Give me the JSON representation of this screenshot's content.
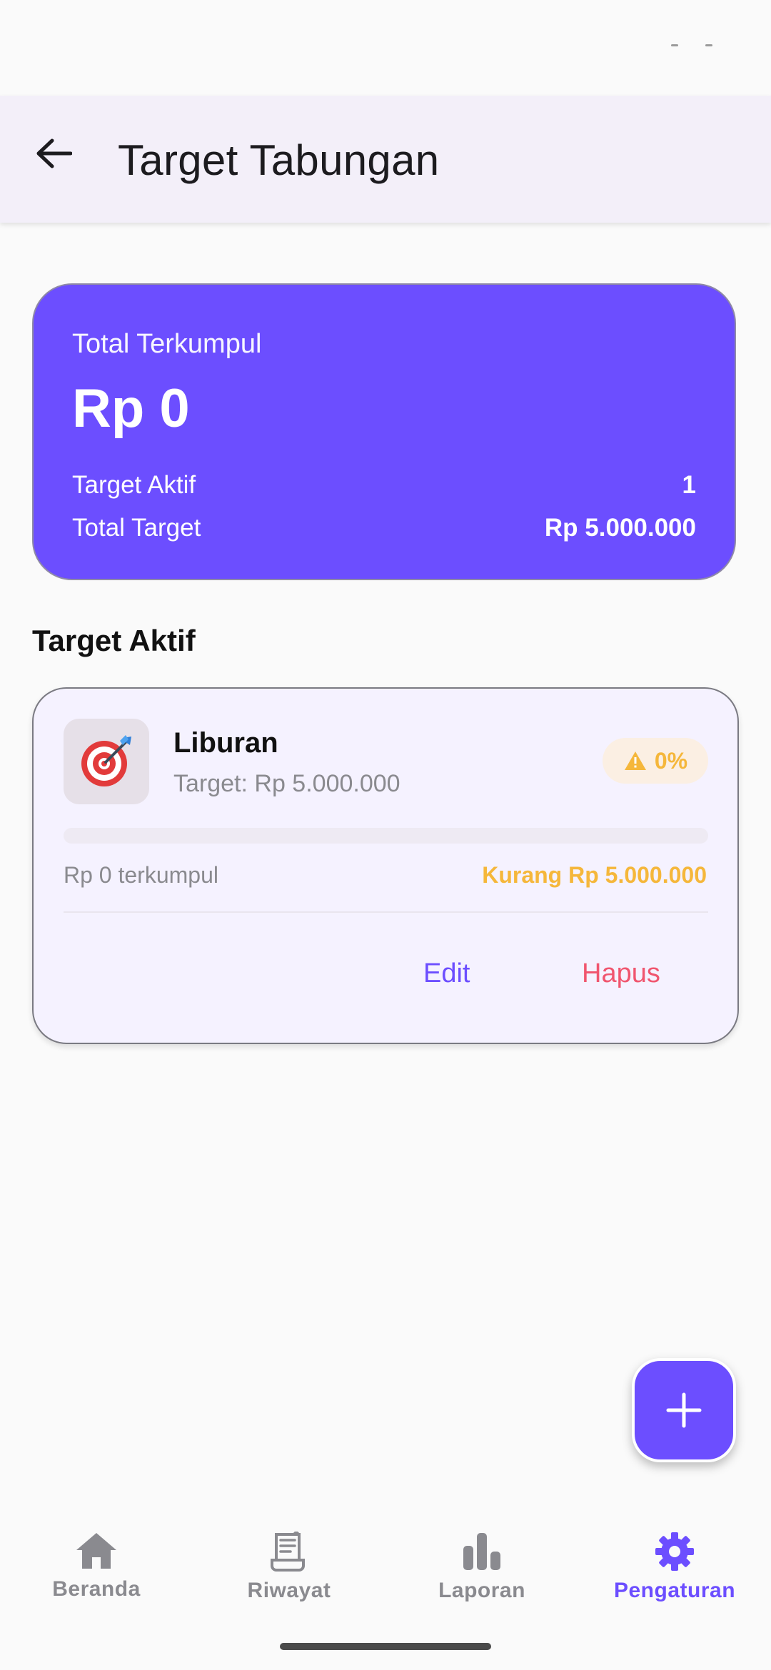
{
  "app_bar": {
    "title": "Target Tabungan"
  },
  "summary": {
    "label": "Total Terkumpul",
    "amount": "Rp 0",
    "active_targets_label": "Target Aktif",
    "active_targets_value": "1",
    "total_target_label": "Total Target",
    "total_target_value": "Rp 5.000.000"
  },
  "section_title": "Target Aktif",
  "goal": {
    "icon": "target-emoji-icon",
    "name": "Liburan",
    "target_text": "Target: Rp 5.000.000",
    "percent": "0%",
    "progress_fraction": 0,
    "collected_text": "Rp 0 terkumpul",
    "shortfall_text": "Kurang Rp 5.000.000",
    "edit_label": "Edit",
    "delete_label": "Hapus"
  },
  "bottom_nav": {
    "items": [
      {
        "label": "Beranda",
        "icon": "home-icon"
      },
      {
        "label": "Riwayat",
        "icon": "receipt-icon"
      },
      {
        "label": "Laporan",
        "icon": "bar-chart-icon"
      },
      {
        "label": "Pengaturan",
        "icon": "gear-icon"
      }
    ],
    "active": "Pengaturan"
  },
  "colors": {
    "primary": "#6C4EFF",
    "warning": "#F5B73B",
    "danger": "#F0566F",
    "app_bar_bg": "#F3EFF9"
  }
}
